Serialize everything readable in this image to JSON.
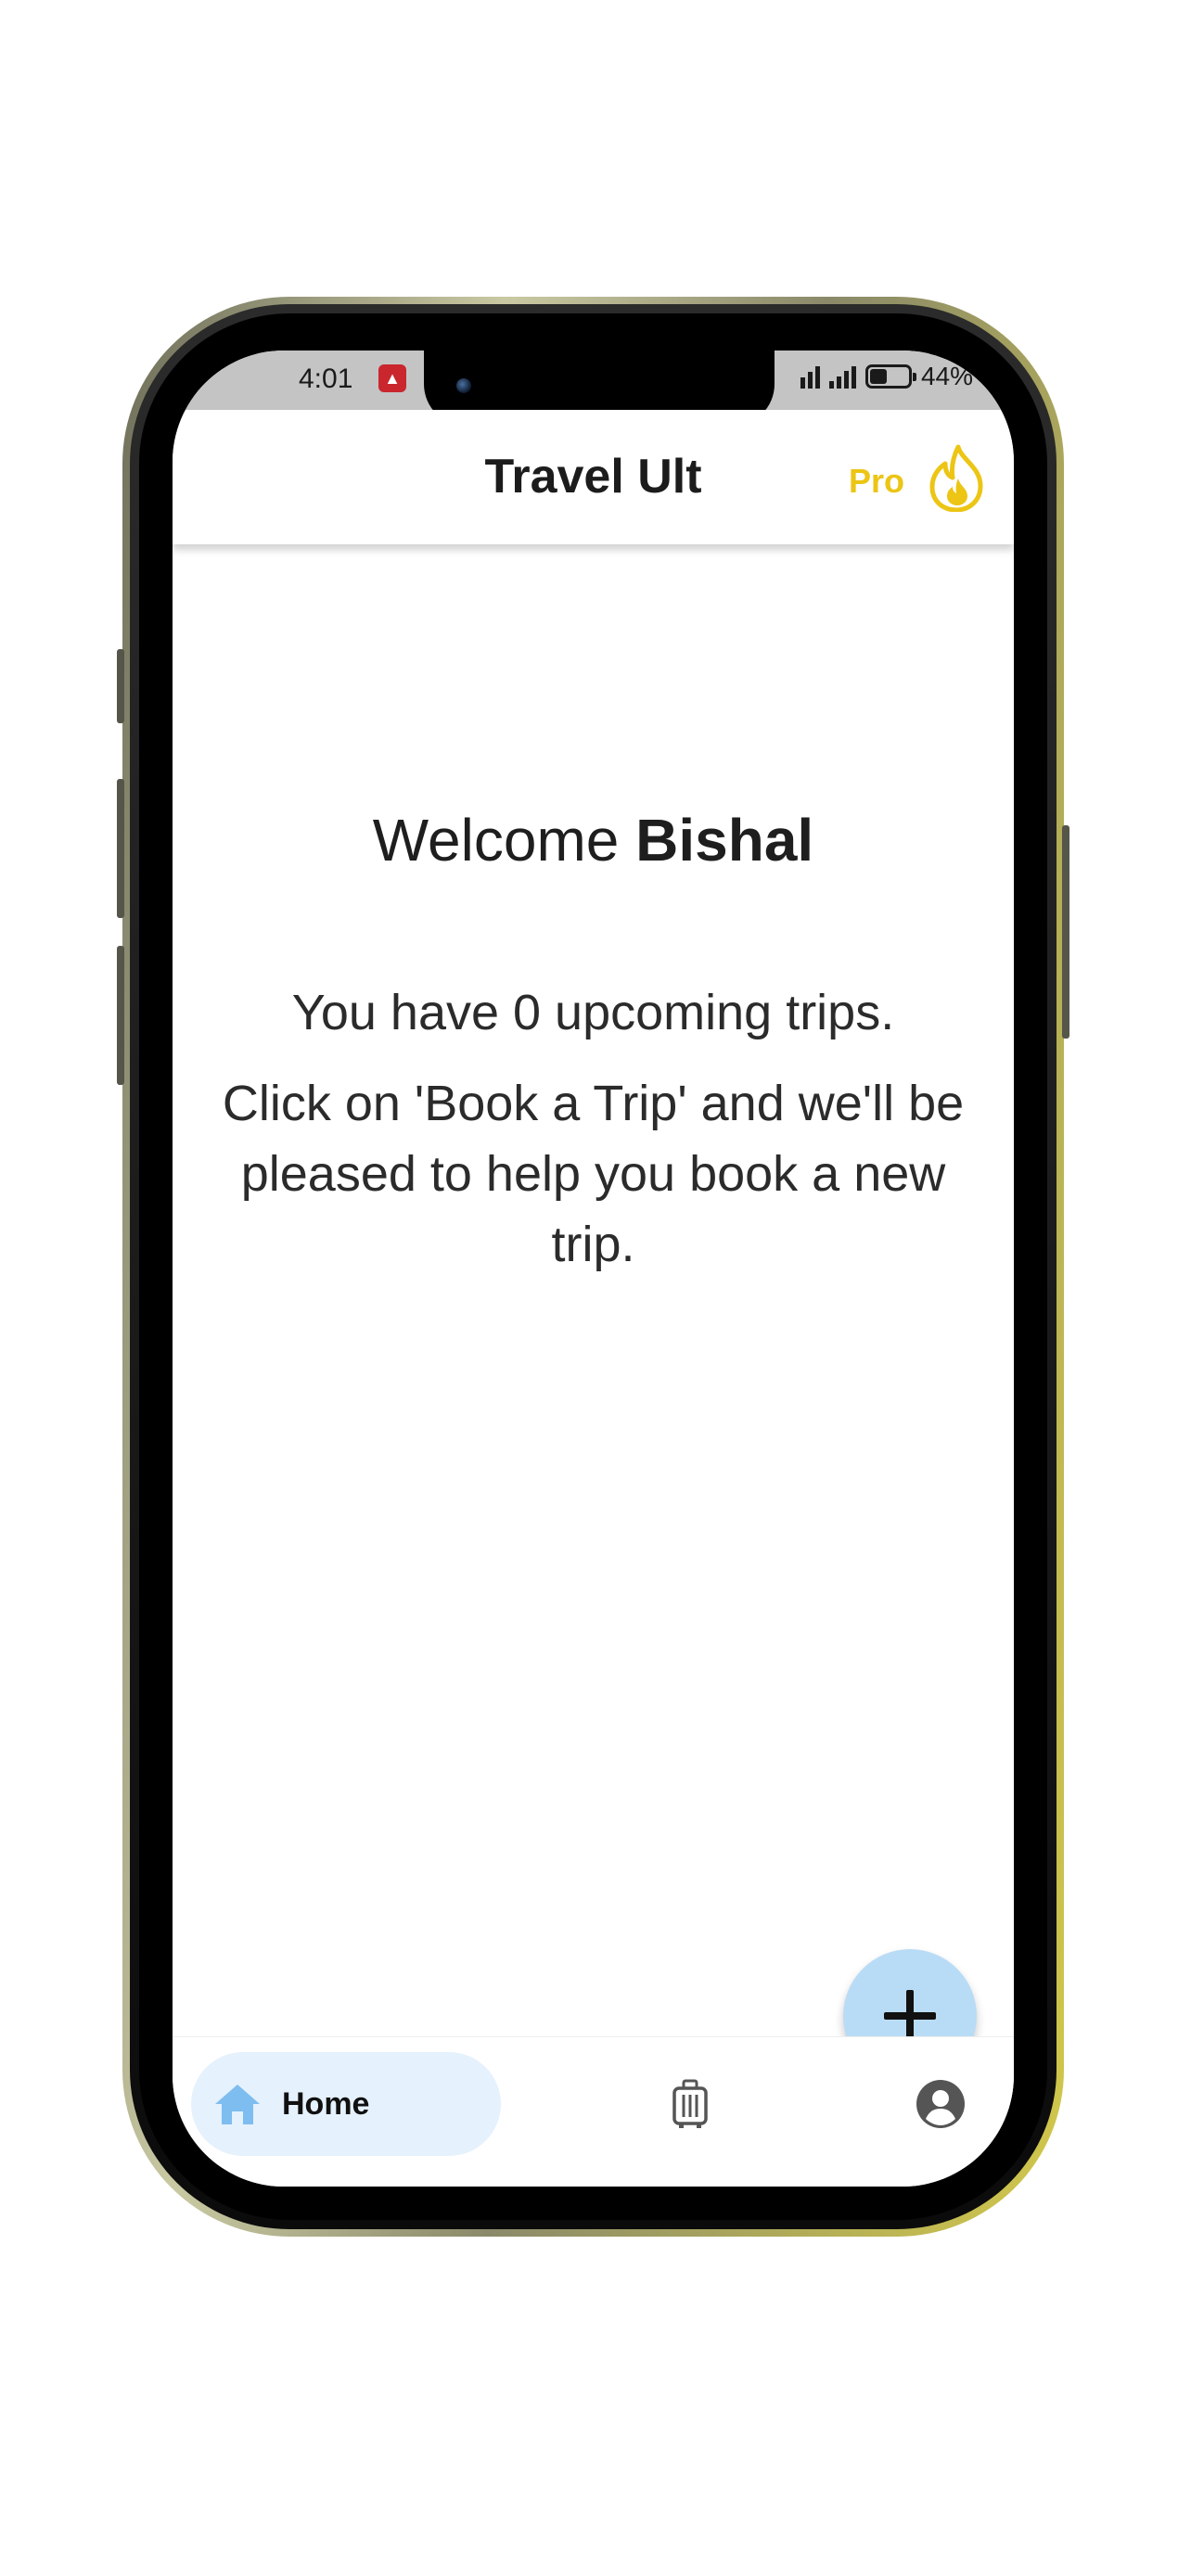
{
  "status_bar": {
    "time": "4:01",
    "battery_percent": "44%",
    "battery_level": 0.44,
    "alert_icon": "alert-app-icon"
  },
  "header": {
    "title": "Travel Ult",
    "pro_label": "Pro",
    "pro_icon": "flame-icon",
    "accent_color": "#ECC515"
  },
  "main": {
    "welcome_prefix": "Welcome",
    "user_name": "Bishal",
    "upcoming_message": "You have 0 upcoming trips.",
    "cta_message": "Click on 'Book a Trip' and we'll be pleased to help you book a new trip."
  },
  "fab": {
    "icon": "plus-icon",
    "color": "#B9DCF6"
  },
  "bottom_nav": {
    "items": [
      {
        "label": "Home",
        "icon": "home-icon",
        "active": true
      },
      {
        "label": "",
        "icon": "luggage-icon",
        "active": false
      },
      {
        "label": "",
        "icon": "account-icon",
        "active": false
      }
    ],
    "active_pill_color": "#E5F1FC"
  }
}
